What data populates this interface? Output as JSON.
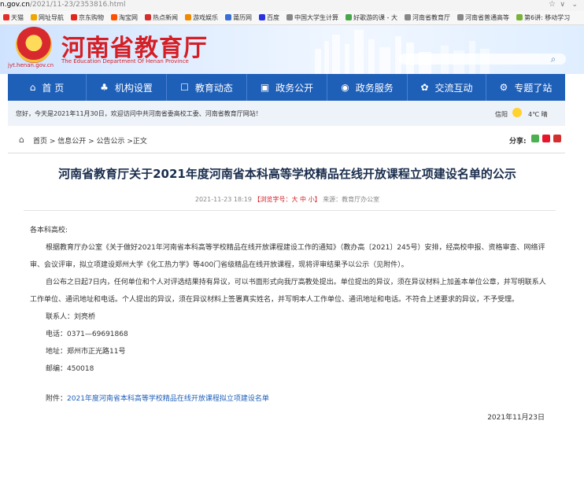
{
  "browser": {
    "url_host": "n.gov.cn",
    "url_path": "/2021/11-23/2353816.html",
    "bookmarks": [
      {
        "label": "天猫",
        "color": "#e62b2b"
      },
      {
        "label": "网址导航",
        "color": "#f0a500"
      },
      {
        "label": "京东购物",
        "color": "#e1251b"
      },
      {
        "label": "淘宝网",
        "color": "#ff5000"
      },
      {
        "label": "热点新闻",
        "color": "#d32f2f"
      },
      {
        "label": "游戏娱乐",
        "color": "#f08a00"
      },
      {
        "label": "莆历网",
        "color": "#3a6fd8"
      },
      {
        "label": "百度",
        "color": "#2932e1"
      },
      {
        "label": "中国大学生计算",
        "color": "#888888"
      },
      {
        "label": "好歌游的课 - 大",
        "color": "#4aa64a"
      },
      {
        "label": "河南省教育厅",
        "color": "#888888"
      },
      {
        "label": "河南省普通高等",
        "color": "#888888"
      },
      {
        "label": "第6讲: 移动学习",
        "color": "#7ab33a"
      }
    ]
  },
  "header": {
    "site_name": "河南省教育厅",
    "site_en": "The Education Department Of Henan Province",
    "domain": "jyt.henan.gov.cn",
    "search_placeholder": ""
  },
  "nav": [
    {
      "label": "首 页",
      "icon": "home-icon",
      "glyph": "⌂"
    },
    {
      "label": "机构设置",
      "icon": "org-icon",
      "glyph": "♣"
    },
    {
      "label": "教育动态",
      "icon": "news-icon",
      "glyph": "☐"
    },
    {
      "label": "政务公开",
      "icon": "doc-icon",
      "glyph": "▣"
    },
    {
      "label": "政务服务",
      "icon": "service-icon",
      "glyph": "◉"
    },
    {
      "label": "交流互动",
      "icon": "chat-icon",
      "glyph": "✿"
    },
    {
      "label": "专题了站",
      "icon": "topic-icon",
      "glyph": "⚙"
    }
  ],
  "welcome": {
    "text": "您好，今天是2021年11月30日，欢迎访问中共河南省委高校工委、河南省教育厅网站！",
    "city": "信阳",
    "temp": "4℃ 晴"
  },
  "breadcrumb": {
    "trail": "首页 > 信息公开 > 公告公示 >正文",
    "share_label": "分享:"
  },
  "article": {
    "title": "河南省教育厅关于2021年度河南省本科高等学校精品在线开放课程立项建设名单的公示",
    "meta_date": "2021-11-23 18:19",
    "meta_size": "【浏览字号：大 中 小】",
    "meta_source": "来源：教育厅办公室",
    "salutation": "各本科高校:",
    "para1": "根据教育厅办公室《关于做好2021年河南省本科高等学校精品在线开放课程建设工作的通知》（教办高〔2021〕245号）安排，经高校申报、资格审查、网络评审、会议评审，拟立项建设郑州大学《化工热力学》等400门省级精品在线开放课程，现将评审结果予以公示（见附件）。",
    "para2": "自公布之日起7日内，任何单位和个人对评选结果持有异议，可以书面形式向我厅高教处提出。单位提出的异议，须在异议材料上加盖本单位公章，并写明联系人工作单位、通讯地址和电话。个人提出的异议，须在异议材料上签署真实姓名，并写明本人工作单位、通讯地址和电话。不符合上述要求的异议，不予受理。",
    "contact": "联系人：刘亮桥",
    "phone": "电话：0371—69691868",
    "address": "地址：郑州市正光路11号",
    "zip": "邮编：450018",
    "attach_label": "附件：",
    "attach_link": "2021年度河南省本科高等学校精品在线开放课程拟立项建设名单",
    "date": "2021年11月23日"
  }
}
